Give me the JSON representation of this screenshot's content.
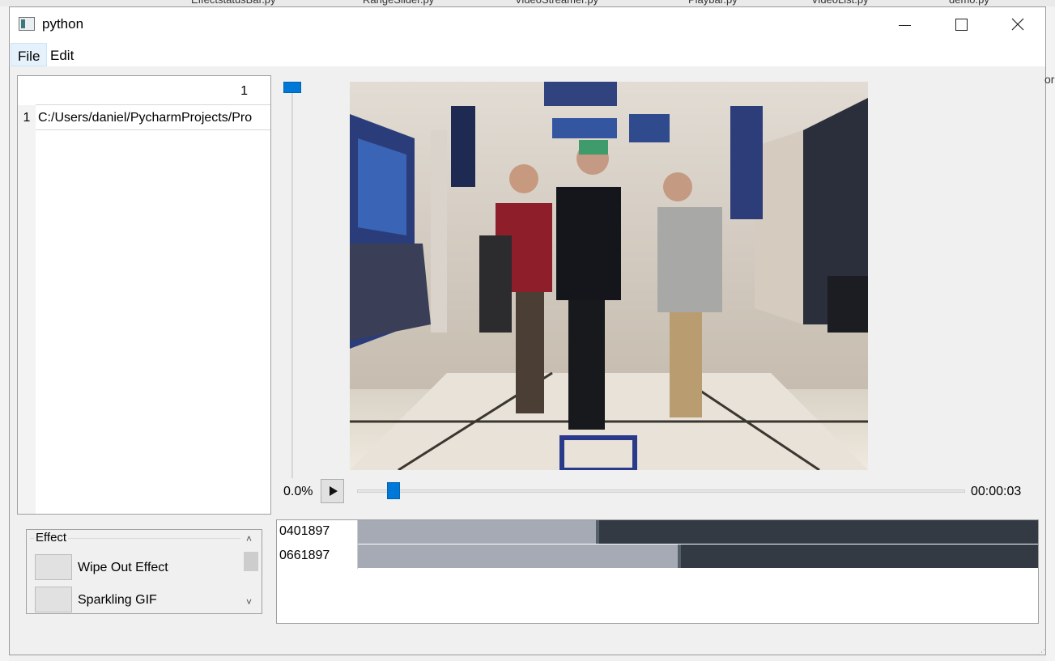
{
  "background_tabs": [
    "EffectstatusBar.py",
    "RangeSlider.py",
    "VideoStreamer.py",
    "Playbar.py",
    "VideoList.py",
    "demo.py"
  ],
  "window": {
    "title": "python",
    "controls": {
      "minimize": "minimize",
      "maximize": "maximize",
      "close": "close"
    }
  },
  "menu": {
    "file": "File",
    "edit": "Edit"
  },
  "file_table": {
    "column_header": "1",
    "rows": [
      {
        "row_number": "1",
        "path": "C:/Users/daniel/PycharmProjects/Pro"
      }
    ]
  },
  "effects": {
    "title": "Effect",
    "items": [
      {
        "label": "Wipe Out Effect"
      },
      {
        "label": "Sparkling GIF"
      }
    ]
  },
  "player": {
    "percent": "0.0%",
    "time": "00:00:03",
    "position_fraction": 0.06
  },
  "tracks": [
    {
      "name": "0401897",
      "progress_fraction": 0.35
    },
    {
      "name": "0661897",
      "progress_fraction": 0.47
    }
  ],
  "colors": {
    "accent": "#0078d7",
    "track_filled": "#a6aab4",
    "track_empty": "#333a44"
  },
  "icons": [
    "app-icon",
    "minimize-icon",
    "maximize-icon",
    "close-icon",
    "play-icon",
    "scroll-up-icon",
    "scroll-down-icon"
  ]
}
